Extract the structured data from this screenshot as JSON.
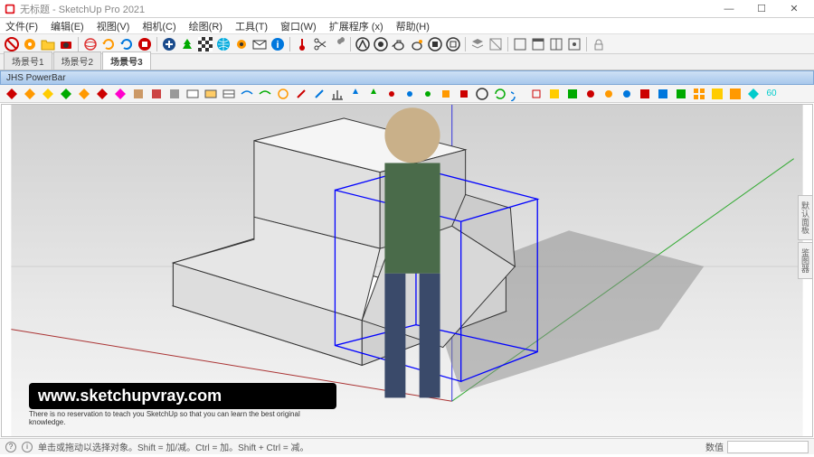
{
  "title": "无标题 - SketchUp Pro 2021",
  "menu": [
    "文件(F)",
    "编辑(E)",
    "视图(V)",
    "相机(C)",
    "绘图(R)",
    "工具(T)",
    "窗口(W)",
    "扩展程序 (x)",
    "帮助(H)"
  ],
  "scenes": [
    "场景号1",
    "场景号2",
    "场景号3"
  ],
  "active_scene_index": 2,
  "powerbar_title": "JHS PowerBar",
  "right_tabs": [
    "默认面板",
    "鉴图器"
  ],
  "watermark_url": "www.sketchupvray.com",
  "watermark_sub": "There is no reservation to teach you SketchUp so that you can learn the best original knowledge.",
  "status_hint": "单击或拖动以选择对象。Shift = 加/减。Ctrl = 加。Shift + Ctrl = 减。",
  "status_measure": "数值",
  "window_btns": {
    "min": "—",
    "max": "☐",
    "close": "✕"
  }
}
